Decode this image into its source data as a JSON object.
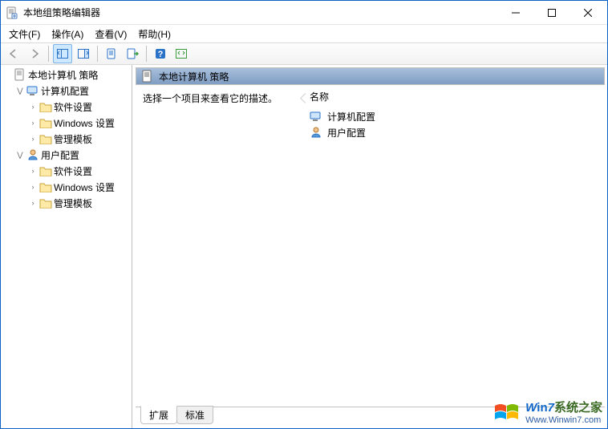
{
  "window": {
    "title": "本地组策略编辑器"
  },
  "menu": {
    "file": "文件(F)",
    "action": "操作(A)",
    "view": "查看(V)",
    "help": "帮助(H)"
  },
  "tree": {
    "root": "本地计算机 策略",
    "computer": "计算机配置",
    "user": "用户配置",
    "software": "软件设置",
    "windows": "Windows 设置",
    "templates": "管理模板"
  },
  "main": {
    "header": "本地计算机 策略",
    "hint": "选择一个项目来查看它的描述。",
    "col_name": "名称",
    "items": {
      "computer": "计算机配置",
      "user": "用户配置"
    }
  },
  "tabs": {
    "ext": "扩展",
    "std": "标准"
  },
  "watermark": {
    "brand_w": "W",
    "brand_in": "in",
    "brand_7": "7",
    "brand_rest": "系统之家",
    "url": "Www.Winwin7.com"
  }
}
